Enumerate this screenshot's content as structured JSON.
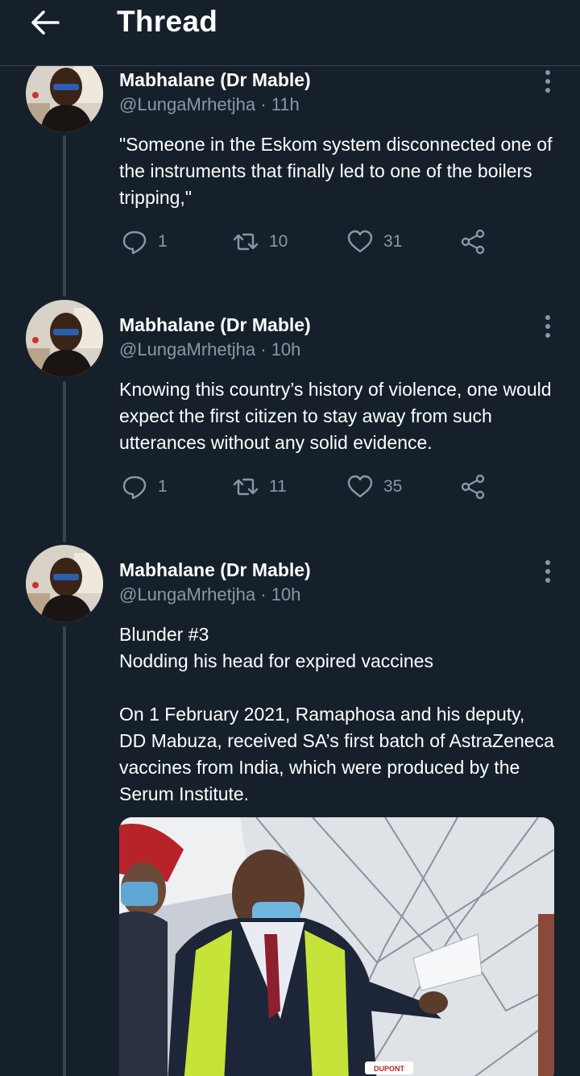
{
  "header": {
    "title": "Thread",
    "back_icon": "arrow-left-icon"
  },
  "colors": {
    "background": "#15202b",
    "secondary_text": "#8899a6",
    "divider": "#38444d"
  },
  "tweets": [
    {
      "name": "Mabhalane (Dr Mable)",
      "handle": "@LungaMrhetjha",
      "separator": "·",
      "time": "11h",
      "text": "\"Someone in the Eskom system disconnected one of the instruments that finally led to one of the boilers tripping,\"",
      "replies": "1",
      "retweets": "10",
      "likes": "31"
    },
    {
      "name": "Mabhalane (Dr Mable)",
      "handle": "@LungaMrhetjha",
      "separator": "·",
      "time": "10h",
      "text": "Knowing this country’s history of violence,  one would expect the first citizen to stay away from such utterances without any solid evidence.",
      "replies": "1",
      "retweets": "11",
      "likes": "35"
    },
    {
      "name": "Mabhalane (Dr Mable)",
      "handle": "@LungaMrhetjha",
      "separator": "·",
      "time": "10h",
      "text": "Blunder #3\nNodding his head for expired vaccines\n\nOn 1 February 2021, Ramaphosa and his deputy, DD Mabuza, received SA’s first batch of AstraZeneca vaccines from India, which were produced by the Serum Institute.",
      "media_label": "DUPONT"
    }
  ]
}
